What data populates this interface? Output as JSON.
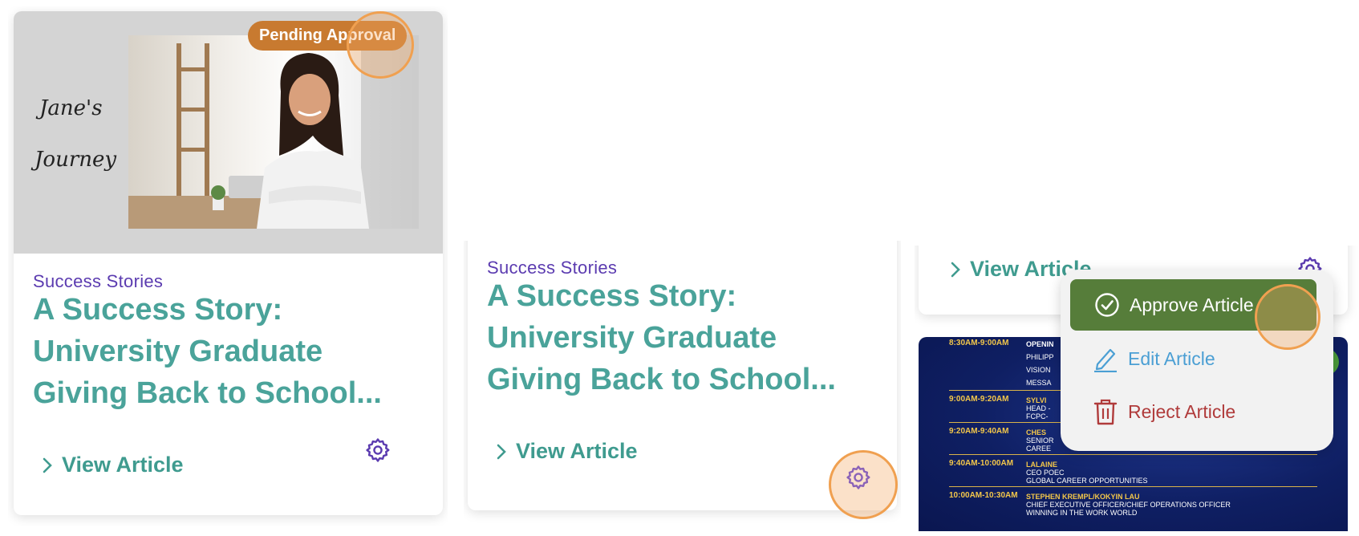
{
  "colors": {
    "category": "#5b3bb0",
    "title": "#4aa39a",
    "badge": "#c87a30",
    "approve": "#567d3a",
    "edit": "#4b9fd4",
    "reject": "#b03b3b",
    "gear": "#5b3bb0",
    "highlight": "#f0a050"
  },
  "card1": {
    "badge": "Pending Approval",
    "image_text_line1": "Jane's",
    "image_text_line2": "Journey",
    "category": "Success Stories",
    "title": "A Success Story: University Graduate Giving Back to School...",
    "view_label": "View Article"
  },
  "card2": {
    "category": "Success Stories",
    "title": "A Success Story: University Graduate Giving Back to School...",
    "view_label": "View Article"
  },
  "card3": {
    "view_label": "View Article"
  },
  "menu": {
    "approve": "Approve Article",
    "edit": "Edit Article",
    "reject": "Reject Article"
  },
  "schedule": [
    {
      "time": "8:30AM-9:00AM",
      "lines": [
        "OPENIN",
        "PHILIPP",
        "VISION",
        "MESSA"
      ]
    },
    {
      "time": "9:00AM-9:20AM",
      "lines": [
        "SYLVI",
        "HEAD -",
        "FCPC-"
      ]
    },
    {
      "time": "9:20AM-9:40AM",
      "lines": [
        "CHES",
        "SENIOR",
        "CAREE"
      ]
    },
    {
      "time": "9:40AM-10:00AM",
      "lines": [
        "LALAINE",
        "CEO POEC",
        "GLOBAL CAREER OPPORTUNITIES"
      ]
    },
    {
      "time": "10:00AM-10:30AM",
      "lines": [
        "STEPHEN KREMPL/KOKYIN LAU",
        "CHIEF EXECUTIVE OFFICER/CHIEF OPERATIONS OFFICER",
        "WINNING IN THE WORK WORLD"
      ]
    }
  ]
}
